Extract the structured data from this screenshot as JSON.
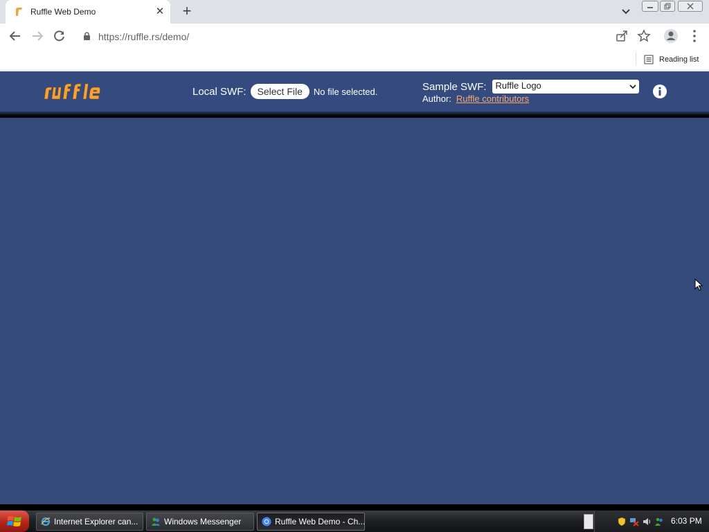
{
  "browser": {
    "tab": {
      "title": "Ruffle Web Demo"
    },
    "address": {
      "url_host": "https://ruffle.rs",
      "url_path": "/demo/"
    },
    "bookmarks": {
      "reading_list": "Reading list"
    }
  },
  "ruffle": {
    "local_swf_label": "Local SWF:",
    "select_file_button": "Select File",
    "file_status": "No file selected.",
    "sample_label": "Sample SWF:",
    "sample_selected": "Ruffle Logo",
    "author_label": "Author:",
    "author_link": "Ruffle contributors"
  },
  "taskbar": {
    "items": [
      {
        "label": "Internet Explorer can...",
        "icon": "ie-icon"
      },
      {
        "label": "Windows Messenger",
        "icon": "messenger-icon"
      },
      {
        "label": "Ruffle Web Demo - Ch...",
        "icon": "chrome-icon"
      }
    ],
    "clock": "6:03 PM"
  },
  "colors": {
    "page_bg": "#344a7b",
    "header_bg": "#354b7f",
    "accent_orange": "#f9a86b",
    "logo_orange": "#f3a33a"
  }
}
